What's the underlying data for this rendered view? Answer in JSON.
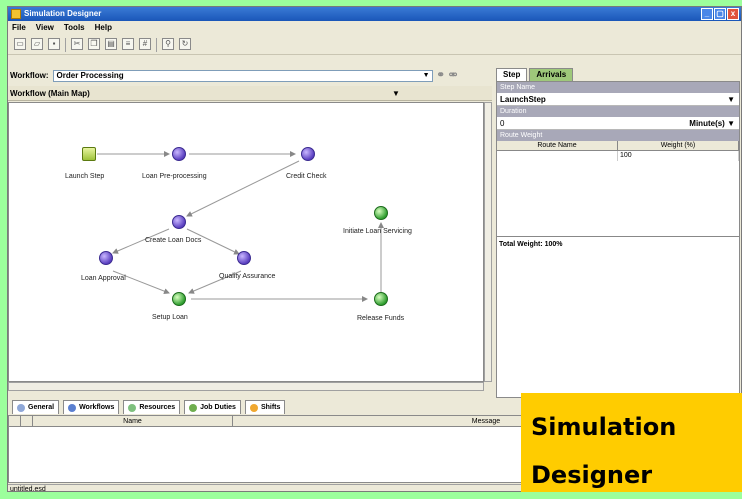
{
  "window": {
    "title": "Simulation Designer",
    "controls": [
      "_",
      "▢",
      "x"
    ]
  },
  "menu": [
    "File",
    "View",
    "Tools",
    "Help"
  ],
  "toolbar": {
    "icons": [
      "new-icon",
      "open-icon",
      "save-icon",
      "cut-icon",
      "copy-icon",
      "paste-icon",
      "align-icon",
      "grid-icon",
      "zoom-icon",
      "refresh-icon"
    ]
  },
  "workflow": {
    "label": "Workflow:",
    "value": "Order Processing"
  },
  "map": {
    "label": "Workflow (Main Map)"
  },
  "nodes": [
    {
      "label": "Launch Step",
      "kind": "launch"
    },
    {
      "label": "Loan Pre-processing",
      "kind": "step"
    },
    {
      "label": "Credit Check",
      "kind": "step"
    },
    {
      "label": "Create Loan Docs",
      "kind": "step"
    },
    {
      "label": "Loan Approval",
      "kind": "step"
    },
    {
      "label": "Quality Assurance",
      "kind": "step"
    },
    {
      "label": "Setup Loan",
      "kind": "green"
    },
    {
      "label": "Initiate Loan Servicing",
      "kind": "green"
    },
    {
      "label": "Release Funds",
      "kind": "green"
    }
  ],
  "right_panel": {
    "tabs": [
      "Step",
      "Arrivals"
    ],
    "step_name_label": "Step Name",
    "step_name_value": "LaunchStep",
    "duration_label": "Duration",
    "duration_value": "0",
    "duration_unit": "Minute(s)",
    "route_weight_label": "Route Weight",
    "columns": [
      "Route Name",
      "Weight (%)"
    ],
    "rows": [
      [
        "",
        "100"
      ]
    ],
    "total_weight": "Total Weight: 100%"
  },
  "bottom_tabs": [
    "General",
    "Workflows",
    "Resources",
    "Job Duties",
    "Shifts"
  ],
  "messages": {
    "columns": [
      "",
      "",
      "Name",
      "Message"
    ]
  },
  "status": "untitled.esd",
  "overlay": {
    "line1": "Simulation",
    "line2": "Designer"
  },
  "colors": {
    "background": "#9cff9c",
    "overlay": "#ffcc00",
    "titlebar": "#1a56b8"
  }
}
